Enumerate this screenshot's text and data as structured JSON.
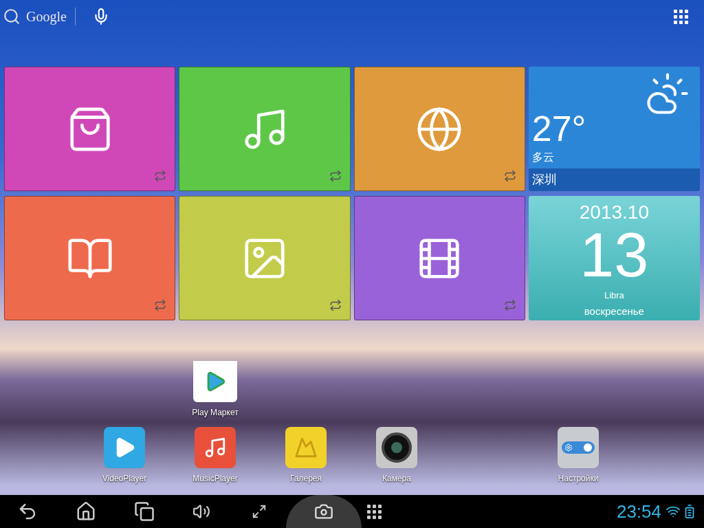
{
  "search": {
    "label": "Google"
  },
  "tiles": [
    {
      "kind": "store",
      "color": "#d048b8"
    },
    {
      "kind": "music",
      "color": "#5ec748"
    },
    {
      "kind": "browser",
      "color": "#de9a3c"
    },
    {
      "kind": "books",
      "color": "#ee6a4c"
    },
    {
      "kind": "gallery",
      "color": "#c2cc4a"
    },
    {
      "kind": "video",
      "color": "#9a62d8"
    }
  ],
  "weather": {
    "temperature": "27°",
    "condition": "多云",
    "city": "深圳"
  },
  "calendar": {
    "month": "2013.10",
    "day": "13",
    "sign": "Libra",
    "weekday": "воскресенье"
  },
  "desktop_apps": [
    {
      "kind": "play",
      "label": "Play Маркет"
    }
  ],
  "dock": [
    {
      "kind": "video",
      "label": "VideoPlayer"
    },
    {
      "kind": "music",
      "label": "MusicPlayer"
    },
    {
      "kind": "gallery",
      "label": "Галерея"
    },
    {
      "kind": "camera",
      "label": "Камера"
    },
    {
      "kind": "settings",
      "label": "Настройки"
    }
  ],
  "status_bar": {
    "time": "23:54"
  }
}
